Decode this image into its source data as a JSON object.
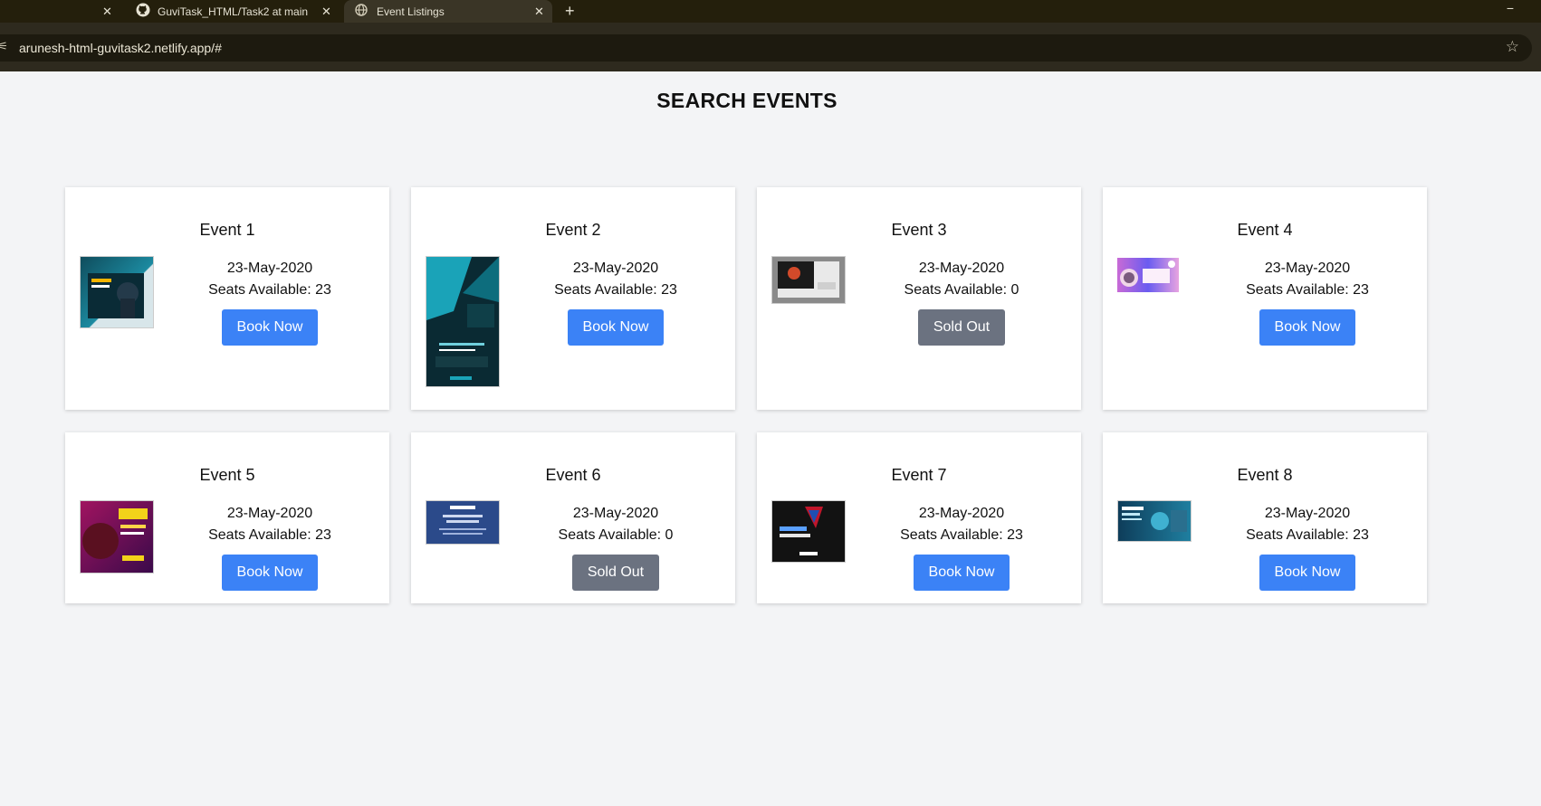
{
  "browser": {
    "tabs": [
      {
        "label": "",
        "active": false
      },
      {
        "label": "GuviTask_HTML/Task2 at main ·",
        "active": false
      },
      {
        "label": "Event Listings",
        "active": true
      }
    ],
    "new_tab": "+",
    "url": "arunesh-html-guvitask2.netlify.app/#",
    "minimize": "−"
  },
  "page": {
    "title": "SEARCH EVENTS"
  },
  "events": [
    {
      "name": "Event 1",
      "date": "23-May-2020",
      "seats": "Seats Available: 23",
      "button": "Book Now",
      "status": "book"
    },
    {
      "name": "Event 2",
      "date": "23-May-2020",
      "seats": "Seats Available: 23",
      "button": "Book Now",
      "status": "book"
    },
    {
      "name": "Event 3",
      "date": "23-May-2020",
      "seats": "Seats Available: 0",
      "button": "Sold Out",
      "status": "sold"
    },
    {
      "name": "Event 4",
      "date": "23-May-2020",
      "seats": "Seats Available: 23",
      "button": "Book Now",
      "status": "book"
    },
    {
      "name": "Event 5",
      "date": "23-May-2020",
      "seats": "Seats Available: 23",
      "button": "Book Now",
      "status": "book"
    },
    {
      "name": "Event 6",
      "date": "23-May-2020",
      "seats": "Seats Available: 0",
      "button": "Sold Out",
      "status": "sold"
    },
    {
      "name": "Event 7",
      "date": "23-May-2020",
      "seats": "Seats Available: 23",
      "button": "Book Now",
      "status": "book"
    },
    {
      "name": "Event 8",
      "date": "23-May-2020",
      "seats": "Seats Available: 23",
      "button": "Book Now",
      "status": "book"
    }
  ],
  "colors": {
    "book_button": "#3b82f6",
    "sold_button": "#6b7280",
    "page_background": "#f3f4f6"
  }
}
